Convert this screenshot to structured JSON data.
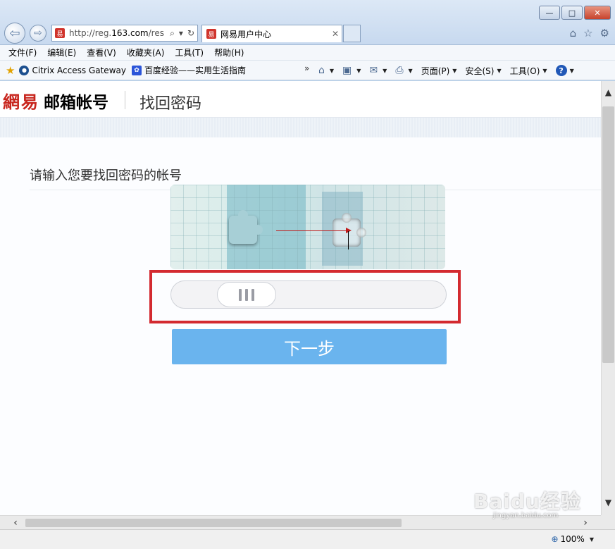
{
  "browser": {
    "address": {
      "url_prefix": "http://reg.",
      "url_domain": "163.com",
      "url_suffix": "/res"
    },
    "tab": {
      "title": "网易用户中心"
    },
    "menu": [
      "文件(F)",
      "编辑(E)",
      "查看(V)",
      "收藏夹(A)",
      "工具(T)",
      "帮助(H)"
    ],
    "favorites": [
      {
        "label": "Citrix Access Gateway"
      },
      {
        "label": "百度经验——实用生活指南"
      }
    ],
    "commands": {
      "page": "页面(P)",
      "safety": "安全(S)",
      "tools": "工具(O)"
    },
    "zoom": "100%",
    "window_buttons": {
      "minimize": "—",
      "maximize": "□",
      "close": "✕"
    }
  },
  "page": {
    "logo": {
      "brand": "網易",
      "product": "邮箱帐号"
    },
    "title": "找回密码",
    "prompt": "请输入您要找回密码的帐号",
    "next_button": "下一步"
  },
  "watermark": {
    "brand": "Baidu经验",
    "url": "jingyan.baidu.com"
  }
}
